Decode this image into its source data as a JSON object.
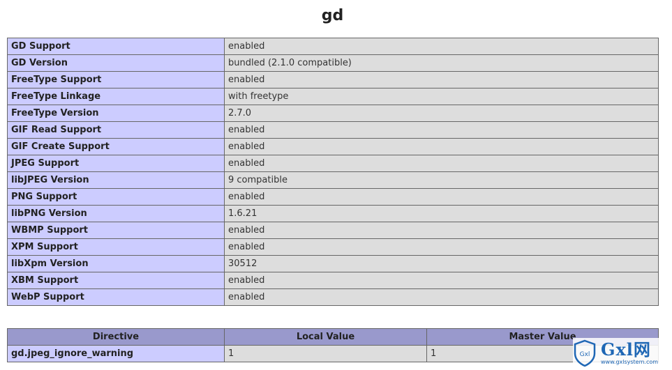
{
  "page": {
    "title": "gd"
  },
  "info_rows": [
    {
      "label": "GD Support",
      "value": "enabled"
    },
    {
      "label": "GD Version",
      "value": "bundled (2.1.0 compatible)"
    },
    {
      "label": "FreeType Support",
      "value": "enabled"
    },
    {
      "label": "FreeType Linkage",
      "value": "with freetype"
    },
    {
      "label": "FreeType Version",
      "value": "2.7.0"
    },
    {
      "label": "GIF Read Support",
      "value": "enabled"
    },
    {
      "label": "GIF Create Support",
      "value": "enabled"
    },
    {
      "label": "JPEG Support",
      "value": "enabled"
    },
    {
      "label": "libJPEG Version",
      "value": "9 compatible"
    },
    {
      "label": "PNG Support",
      "value": "enabled"
    },
    {
      "label": "libPNG Version",
      "value": "1.6.21"
    },
    {
      "label": "WBMP Support",
      "value": "enabled"
    },
    {
      "label": "XPM Support",
      "value": "enabled"
    },
    {
      "label": "libXpm Version",
      "value": "30512"
    },
    {
      "label": "XBM Support",
      "value": "enabled"
    },
    {
      "label": "WebP Support",
      "value": "enabled"
    }
  ],
  "directive_table": {
    "headers": [
      "Directive",
      "Local Value",
      "Master Value"
    ],
    "rows": [
      {
        "directive": "gd.jpeg_ignore_warning",
        "local": "1",
        "master": "1"
      }
    ]
  },
  "watermark": {
    "brand": "Gxl网",
    "url": "www.gxlsystem.com",
    "shield_text": "Gxl",
    "color": "#1f67b5"
  }
}
